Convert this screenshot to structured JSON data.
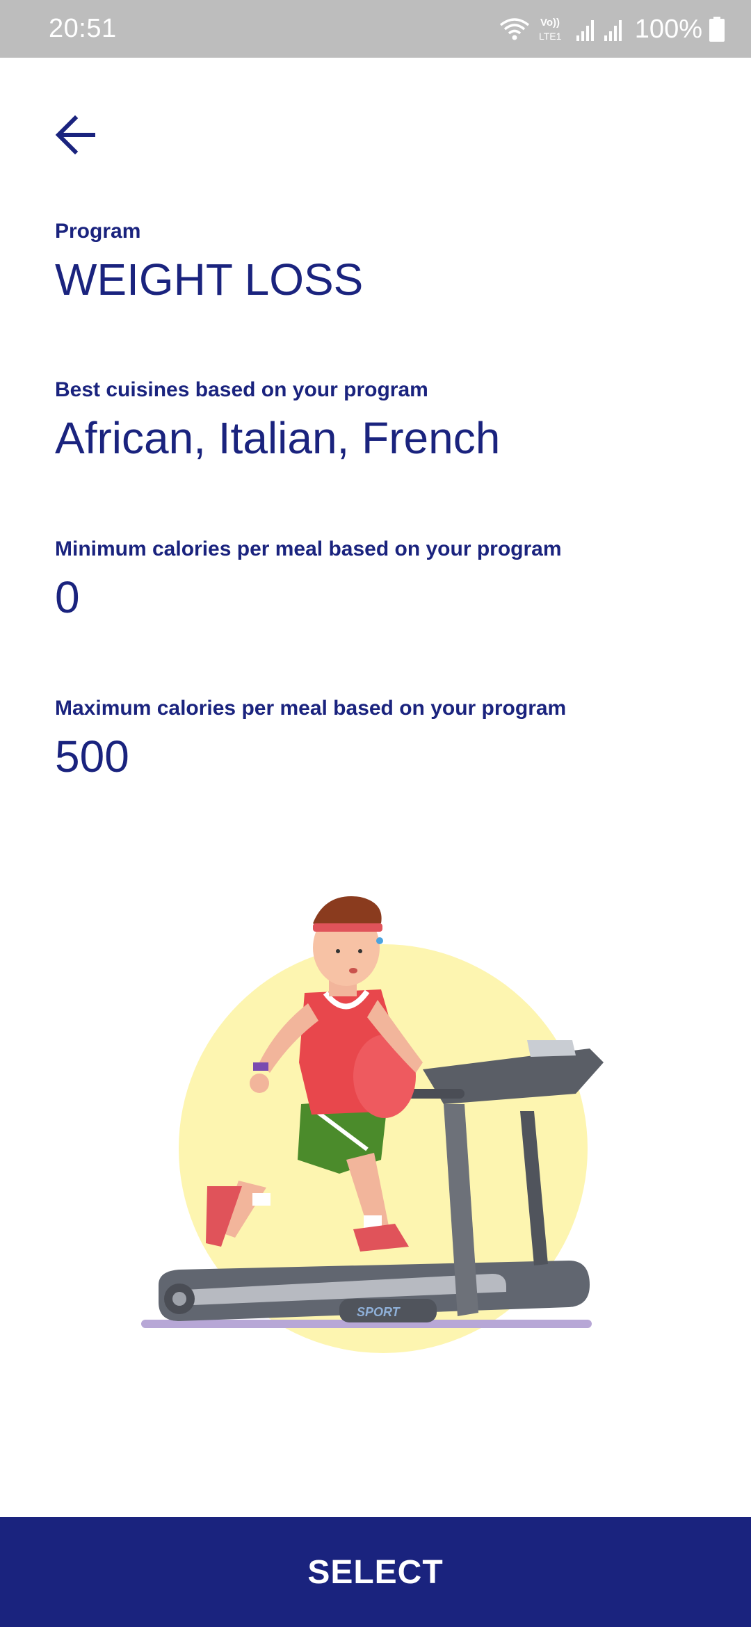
{
  "status_bar": {
    "time": "20:51",
    "battery": "100%",
    "network_label": "Vo)) LTE1"
  },
  "program": {
    "label": "Program",
    "value": "WEIGHT LOSS"
  },
  "cuisines": {
    "label": "Best cuisines based on your program",
    "value": "African, Italian, French"
  },
  "min_calories": {
    "label": "Minimum calories per meal based on your program",
    "value": "0"
  },
  "max_calories": {
    "label": "Maximum calories per meal based on your program",
    "value": "500"
  },
  "illustration": {
    "treadmill_text": "SPORT"
  },
  "select_button": {
    "label": "SELECT"
  },
  "colors": {
    "primary": "#1a237e",
    "status_bar": "#bdbdbd",
    "sun": "#fdf5b0"
  }
}
